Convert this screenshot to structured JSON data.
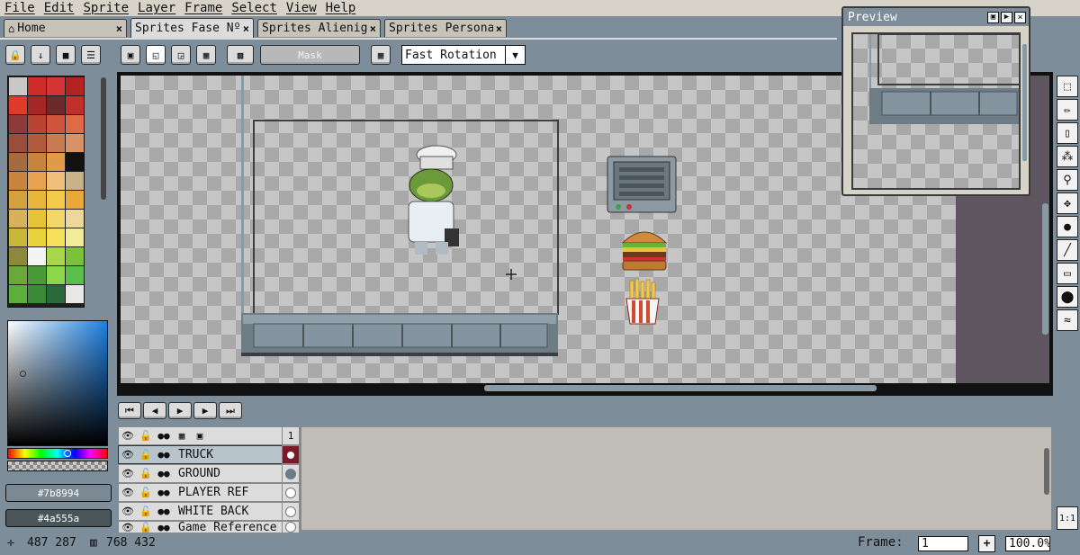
{
  "menu": [
    "File",
    "Edit",
    "Sprite",
    "Layer",
    "Frame",
    "Select",
    "View",
    "Help"
  ],
  "tabs": [
    {
      "label": "Home",
      "icon": "home-icon"
    },
    {
      "label": "Sprites Fase Nº"
    },
    {
      "label": "Sprites Alienige"
    },
    {
      "label": "Sprites Persona"
    }
  ],
  "tab_close": "×",
  "toolbar": {
    "mask_label": "Mask",
    "rotation_select": "Fast Rotation"
  },
  "palette_colors": [
    "#c8c8c8",
    "#d02b2b",
    "#d43434",
    "#b22222",
    "#e03a2a",
    "#a82525",
    "#6d2a2a",
    "#c02f28",
    "#8e3a3a",
    "#b94434",
    "#d0533c",
    "#e06a45",
    "#9a4d3a",
    "#b25a3e",
    "#c97a52",
    "#d8926a",
    "#a66a3e",
    "#c7843e",
    "#e09a4a",
    "#111111",
    "#c9853d",
    "#e6a24f",
    "#efc07a",
    "#c9b28a",
    "#d4a13c",
    "#e8b63a",
    "#f2c94d",
    "#e8a83a",
    "#d6b25a",
    "#e8c23a",
    "#f2d86a",
    "#ecd89a",
    "#c9b63a",
    "#e8d43a",
    "#f4e05a",
    "#f2ec9a",
    "#8a8a3a",
    "#f4f4f4",
    "#a8d84a",
    "#7ac23a",
    "#6aa83a",
    "#4a9a3a",
    "#8ad84a",
    "#5abf4a",
    "#5ab03a",
    "#3a8a3a",
    "#2a6a3a",
    "#e8e8e8"
  ],
  "colors": {
    "foreground": "#7b8994",
    "background": "#4a555a"
  },
  "preview": {
    "title": "Preview"
  },
  "tools": [
    "marquee-icon",
    "pencil-icon",
    "eraser-icon",
    "eyedropper-icon",
    "zoom-icon",
    "move-icon",
    "fill-icon",
    "line-icon",
    "rectangle-icon",
    "ellipse-icon",
    "blur-icon"
  ],
  "timeline": {
    "frame_header": "1",
    "layers": [
      {
        "name": "TRUCK",
        "selected": true
      },
      {
        "name": "GROUND"
      },
      {
        "name": "PLAYER REF"
      },
      {
        "name": "WHITE BACK"
      },
      {
        "name": "Game Reference"
      }
    ]
  },
  "zoom_button": "1:1",
  "status": {
    "cursor": "487 287",
    "size": "768 432",
    "frame_label": "Frame:",
    "frame_value": "1",
    "zoom_value": "100.0%",
    "plus": "+"
  }
}
